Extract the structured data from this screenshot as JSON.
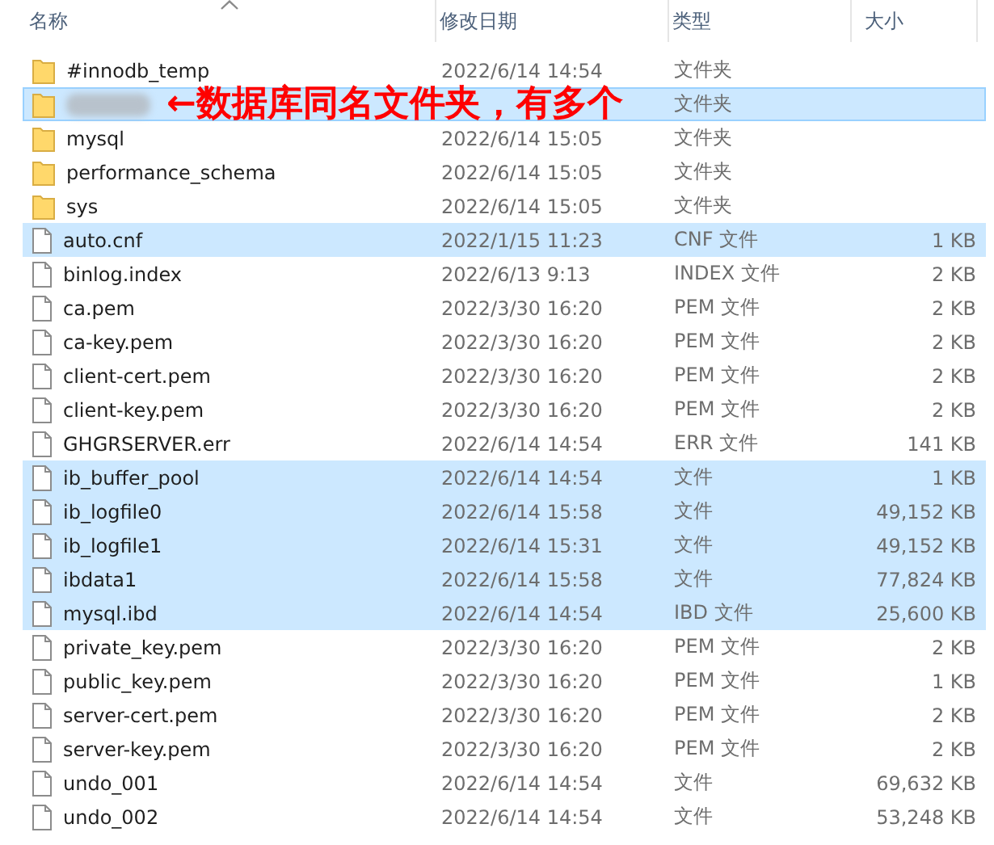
{
  "columns": [
    {
      "label": "名称",
      "sorted": true
    },
    {
      "label": "修改日期",
      "sorted": false
    },
    {
      "label": "类型",
      "sorted": false
    },
    {
      "label": "大小",
      "sorted": false
    }
  ],
  "rows": [
    {
      "kind": "folder",
      "name": "#innodb_temp",
      "date": "2022/6/14 14:54",
      "type": "文件夹",
      "selected": false,
      "focused": false
    },
    {
      "kind": "folder",
      "redacted": true,
      "type": "文件夹",
      "selected": true,
      "focused": true
    },
    {
      "kind": "folder",
      "name": "mysql",
      "date": "2022/6/14 15:05",
      "type": "文件夹",
      "selected": false,
      "focused": false
    },
    {
      "kind": "folder",
      "name": "performance_schema",
      "date": "2022/6/14 15:05",
      "type": "文件夹",
      "selected": false,
      "focused": false
    },
    {
      "kind": "folder",
      "name": "sys",
      "date": "2022/6/14 15:05",
      "type": "文件夹",
      "selected": false,
      "focused": false
    },
    {
      "kind": "file",
      "name": "auto.cnf",
      "date": "2022/1/15 11:23",
      "type": "CNF 文件",
      "size": "1 KB",
      "selected": true,
      "focused": false
    },
    {
      "kind": "file",
      "name": "binlog.index",
      "date": "2022/6/13 9:13",
      "type": "INDEX 文件",
      "size": "2 KB",
      "selected": false,
      "focused": false
    },
    {
      "kind": "file",
      "name": "ca.pem",
      "date": "2022/3/30 16:20",
      "type": "PEM 文件",
      "size": "2 KB",
      "selected": false,
      "focused": false
    },
    {
      "kind": "file",
      "name": "ca-key.pem",
      "date": "2022/3/30 16:20",
      "type": "PEM 文件",
      "size": "2 KB",
      "selected": false,
      "focused": false
    },
    {
      "kind": "file",
      "name": "client-cert.pem",
      "date": "2022/3/30 16:20",
      "type": "PEM 文件",
      "size": "2 KB",
      "selected": false,
      "focused": false
    },
    {
      "kind": "file",
      "name": "client-key.pem",
      "date": "2022/3/30 16:20",
      "type": "PEM 文件",
      "size": "2 KB",
      "selected": false,
      "focused": false
    },
    {
      "kind": "file",
      "name": "GHGRSERVER.err",
      "date": "2022/6/14 14:54",
      "type": "ERR 文件",
      "size": "141 KB",
      "selected": false,
      "focused": false
    },
    {
      "kind": "file",
      "name": "ib_buffer_pool",
      "date": "2022/6/14 14:54",
      "type": "文件",
      "size": "1 KB",
      "selected": true,
      "focused": false
    },
    {
      "kind": "file",
      "name": "ib_logfile0",
      "date": "2022/6/14 15:58",
      "type": "文件",
      "size": "49,152 KB",
      "selected": true,
      "focused": false
    },
    {
      "kind": "file",
      "name": "ib_logfile1",
      "date": "2022/6/14 15:31",
      "type": "文件",
      "size": "49,152 KB",
      "selected": true,
      "focused": false
    },
    {
      "kind": "file",
      "name": "ibdata1",
      "date": "2022/6/14 15:58",
      "type": "文件",
      "size": "77,824 KB",
      "selected": true,
      "focused": false
    },
    {
      "kind": "file",
      "name": "mysql.ibd",
      "date": "2022/6/14 14:54",
      "type": "IBD 文件",
      "size": "25,600 KB",
      "selected": true,
      "focused": false
    },
    {
      "kind": "file",
      "name": "private_key.pem",
      "date": "2022/3/30 16:20",
      "type": "PEM 文件",
      "size": "2 KB",
      "selected": false,
      "focused": false
    },
    {
      "kind": "file",
      "name": "public_key.pem",
      "date": "2022/3/30 16:20",
      "type": "PEM 文件",
      "size": "1 KB",
      "selected": false,
      "focused": false
    },
    {
      "kind": "file",
      "name": "server-cert.pem",
      "date": "2022/3/30 16:20",
      "type": "PEM 文件",
      "size": "2 KB",
      "selected": false,
      "focused": false
    },
    {
      "kind": "file",
      "name": "server-key.pem",
      "date": "2022/3/30 16:20",
      "type": "PEM 文件",
      "size": "2 KB",
      "selected": false,
      "focused": false
    },
    {
      "kind": "file",
      "name": "undo_001",
      "date": "2022/6/14 14:54",
      "type": "文件",
      "size": "69,632 KB",
      "selected": false,
      "focused": false
    },
    {
      "kind": "file",
      "name": "undo_002",
      "date": "2022/6/14 14:54",
      "type": "文件",
      "size": "53,248 KB",
      "selected": false,
      "focused": false
    }
  ],
  "annotation": {
    "text": "←数据库同名文件夹，有多个"
  }
}
